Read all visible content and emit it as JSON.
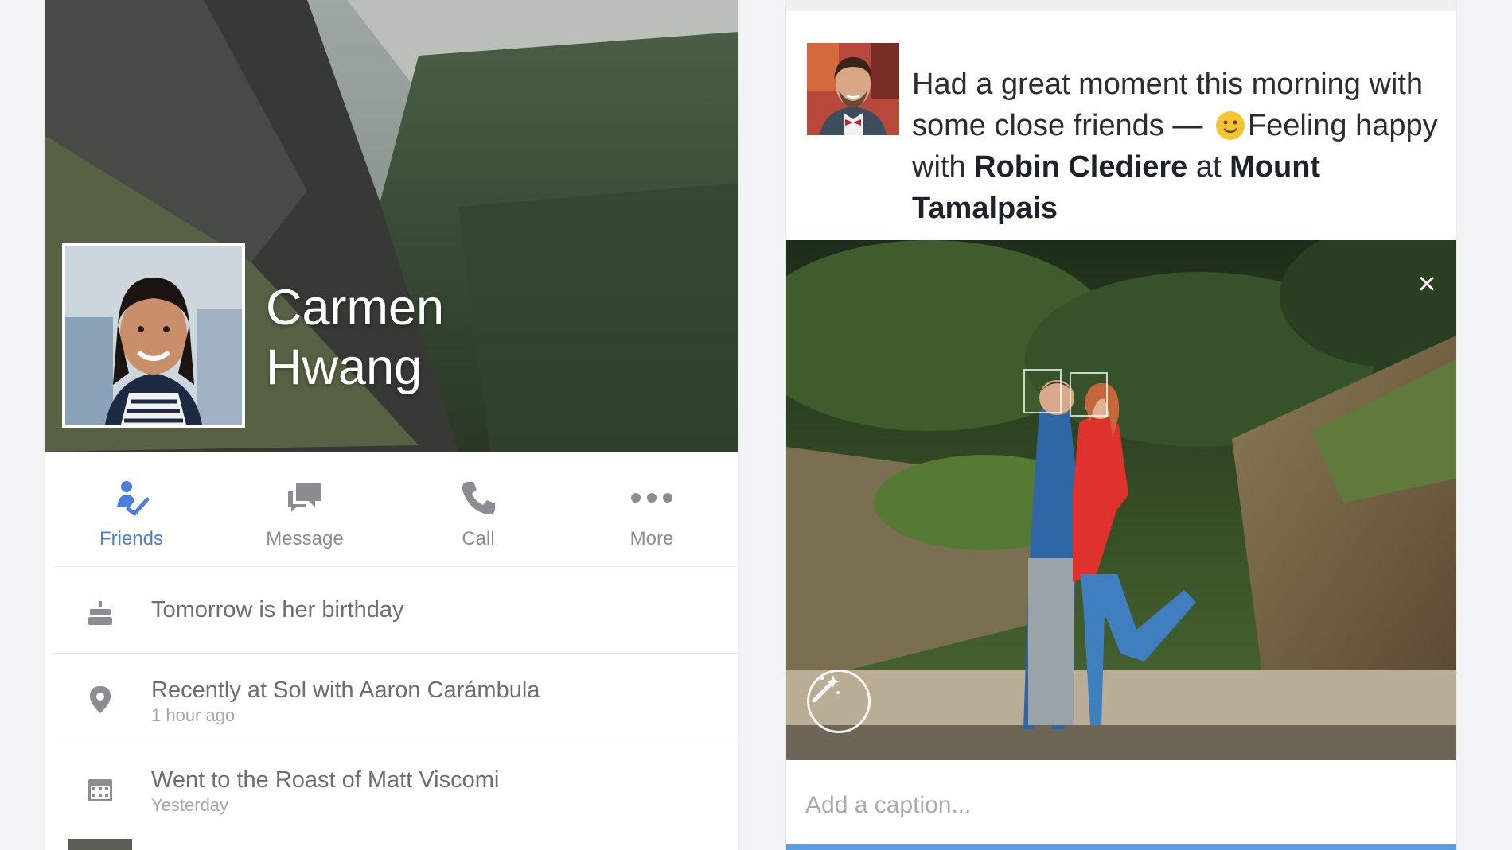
{
  "profile": {
    "name_line1": "Carmen",
    "name_line2": "Hwang",
    "actions": [
      {
        "label": "Friends",
        "icon": "friends-check-icon",
        "active": true
      },
      {
        "label": "Message",
        "icon": "message-bubbles-icon",
        "active": false
      },
      {
        "label": "Call",
        "icon": "phone-icon",
        "active": false
      },
      {
        "label": "More",
        "icon": "more-dots-icon",
        "active": false
      }
    ],
    "info": [
      {
        "icon": "birthday-cake-icon",
        "primary": "Tomorrow is her birthday",
        "secondary": ""
      },
      {
        "icon": "location-pin-icon",
        "primary": "Recently at Sol with Aaron Carámbula",
        "secondary": "1 hour ago"
      },
      {
        "icon": "calendar-icon",
        "primary": "Went to the Roast of Matt Viscomi",
        "secondary": "Yesterday"
      }
    ]
  },
  "post": {
    "text_start": "Had a great moment this morning with some close friends — ",
    "text_feeling": "Feeling happy with ",
    "tagged_person": "Robin Clediere",
    "text_at": " at ",
    "place_line1": "Mount",
    "place_line2": "Tamalpais",
    "close_label": "×",
    "caption_placeholder": "Add a caption..."
  },
  "colors": {
    "accent": "#4a7fdc",
    "muted_text": "#8a8d91",
    "caption_bar": "#5b9be0"
  }
}
